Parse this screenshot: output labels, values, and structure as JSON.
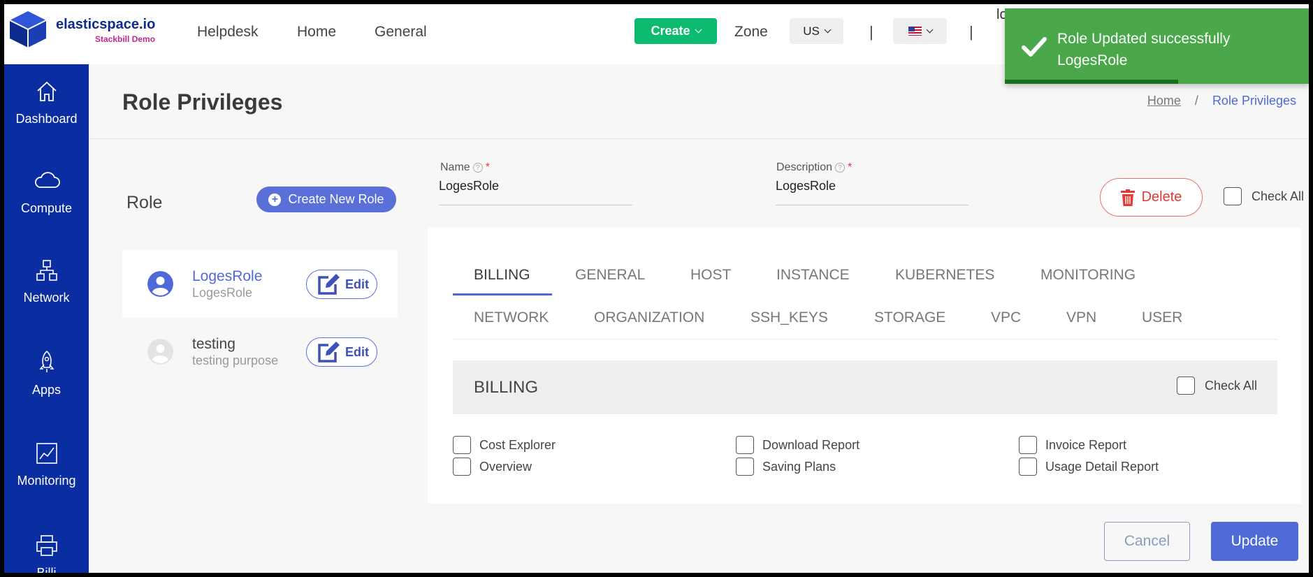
{
  "brand": {
    "title": "elasticspace.io",
    "subtitle": "Stackbill Demo"
  },
  "topnav": {
    "links": [
      "Helpdesk",
      "Home",
      "General"
    ],
    "create_label": "Create",
    "zone_label": "Zone",
    "zone_value": "US",
    "separator": "|",
    "user_text": "lo"
  },
  "toast": {
    "line1": "Role Updated successfully",
    "line2": "LogesRole",
    "progress": 0.57,
    "color": "#4aa84a"
  },
  "sidebar": {
    "items": [
      {
        "label": "Dashboard",
        "icon": "home-icon"
      },
      {
        "label": "Compute",
        "icon": "cloud-icon"
      },
      {
        "label": "Network",
        "icon": "network-icon"
      },
      {
        "label": "Apps",
        "icon": "rocket-icon"
      },
      {
        "label": "Monitoring",
        "icon": "chart-icon"
      },
      {
        "label": "Billi",
        "icon": "printer-icon"
      }
    ]
  },
  "page": {
    "title": "Role Privileges"
  },
  "breadcrumb": {
    "home": "Home",
    "separator": "/",
    "current": "Role Privileges"
  },
  "roles": {
    "heading": "Role",
    "create_label": "Create New Role",
    "edit_label": "Edit",
    "items": [
      {
        "name": "LogesRole",
        "description": "LogesRole"
      },
      {
        "name": "testing",
        "description": "testing purpose"
      }
    ]
  },
  "form": {
    "name_label": "Name",
    "name_value": "LogesRole",
    "description_label": "Description",
    "description_value": "LogesRole",
    "required_mark": "*",
    "help_mark": "?",
    "delete_label": "Delete",
    "check_all_label": "Check All"
  },
  "tabs": {
    "row1": [
      "BILLING",
      "GENERAL",
      "HOST",
      "INSTANCE",
      "KUBERNETES",
      "MONITORING"
    ],
    "row2": [
      "NETWORK",
      "ORGANIZATION",
      "SSH_KEYS",
      "STORAGE",
      "VPC",
      "VPN",
      "USER"
    ],
    "active": "BILLING"
  },
  "section": {
    "title": "BILLING",
    "check_all_label": "Check All",
    "permissions": [
      "Cost Explorer",
      "Download Report",
      "Invoice Report",
      "Overview",
      "Saving Plans",
      "Usage Detail Report"
    ]
  },
  "actions": {
    "cancel_label": "Cancel",
    "update_label": "Update"
  },
  "colors": {
    "primary": "#4f6ad6",
    "sidebar": "#0a2ea1",
    "create": "#0cbb6f",
    "danger": "#e53935"
  }
}
